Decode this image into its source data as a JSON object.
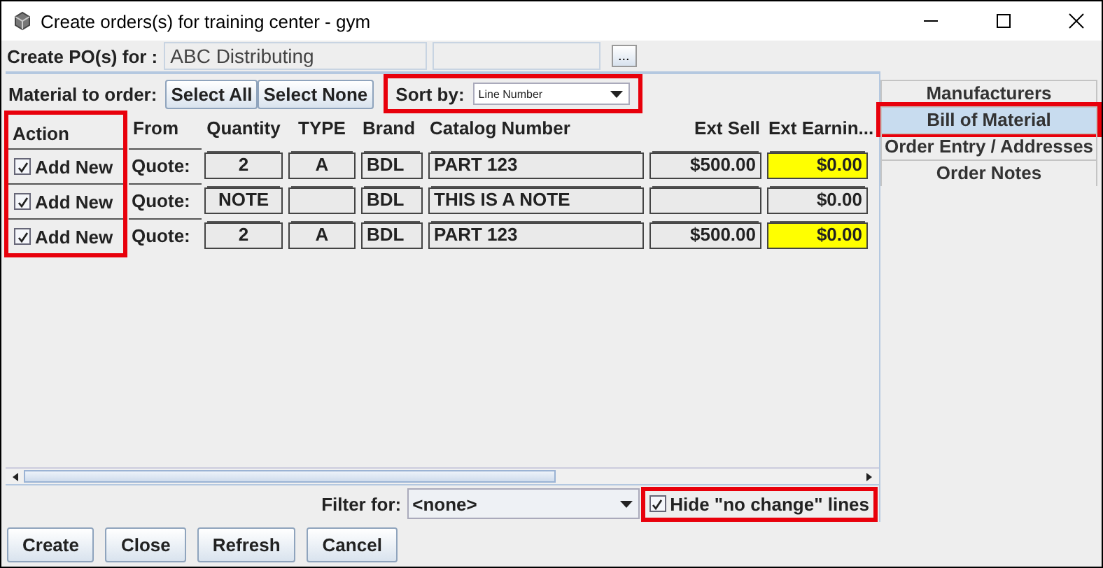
{
  "window": {
    "title": "Create orders(s) for training center - gym"
  },
  "po_for": {
    "label": "Create PO(s) for :",
    "value": "ABC Distributing",
    "browse_button": "..."
  },
  "toolbar": {
    "label": "Material to order:",
    "buttons": [
      "Select All",
      "Select None"
    ],
    "sort": {
      "label": "Sort by:",
      "value": "Line Number",
      "highlighted": true
    }
  },
  "table": {
    "action_highlighted": true,
    "columns": [
      "Action",
      "From",
      "Quantity",
      "TYPE",
      "Brand",
      "Catalog Number",
      "Ext Sell",
      "Ext Earnin..."
    ],
    "rows": [
      {
        "checked": true,
        "action": "Add New",
        "from": "Quote:",
        "quantity": "2",
        "type": "A",
        "brand": "BDL",
        "catalog_number": "PART 123",
        "ext_sell": "$500.00",
        "ext_earnings": "$0.00",
        "flagged": true
      },
      {
        "checked": true,
        "action": "Add New",
        "from": "Quote:",
        "quantity": "NOTE",
        "type": "",
        "brand": "BDL",
        "catalog_number": "THIS IS A NOTE",
        "ext_sell": "",
        "ext_earnings": "$0.00",
        "flagged": false
      },
      {
        "checked": true,
        "action": "Add New",
        "from": "Quote:",
        "quantity": "2",
        "type": "A",
        "brand": "BDL",
        "catalog_number": "PART 123",
        "ext_sell": "$500.00",
        "ext_earnings": "$0.00",
        "flagged": true
      }
    ]
  },
  "tabs": [
    {
      "label": "Manufacturers",
      "selected": false,
      "highlighted": false
    },
    {
      "label": "Bill of Material",
      "selected": true,
      "highlighted": true
    },
    {
      "label": "Order Entry / Addresses",
      "selected": false,
      "highlighted": false
    },
    {
      "label": "Order Notes",
      "selected": false,
      "highlighted": false
    }
  ],
  "filter": {
    "label": "Filter for:",
    "value": "<none>"
  },
  "hide_no_change": {
    "label": "Hide \"no change\" lines",
    "checked": true,
    "highlighted": true
  },
  "buttons": [
    "Create",
    "Close",
    "Refresh",
    "Cancel"
  ]
}
